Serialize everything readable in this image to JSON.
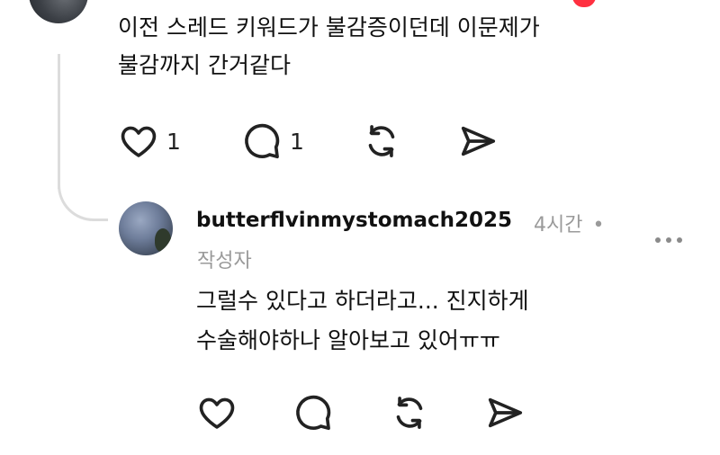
{
  "parent_comment": {
    "lines": [
      "이전 스레드 키워드가 불감증이던데 이문제가",
      "불감까지 간거같다"
    ],
    "likes": "1",
    "replies": "1"
  },
  "reply": {
    "username": "butterflvinmystomach2025",
    "time": "4시간",
    "separator": "•",
    "author_badge": "작성자",
    "lines": [
      "그럴수 있다고 하더라고... 진지하게",
      "수술해야하나 알아보고 있어ㅠㅠ"
    ]
  },
  "icons": {
    "like": "heart-icon",
    "comment": "comment-icon",
    "repost": "repost-icon",
    "share": "share-icon",
    "more": "more-icon"
  },
  "colors": {
    "text": "#111111",
    "meta": "#9a9a9a",
    "thread_line": "#dcdcdc",
    "like_badge": "#ff3040"
  }
}
